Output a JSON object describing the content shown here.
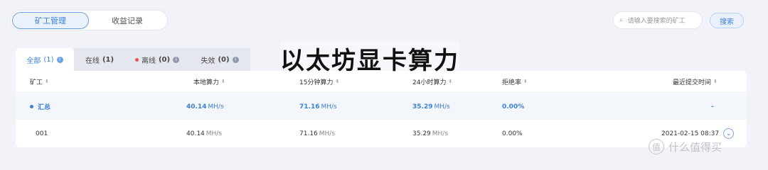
{
  "top_tabs": [
    {
      "label": "矿工管理",
      "active": true
    },
    {
      "label": "收益记录",
      "active": false
    }
  ],
  "search": {
    "placeholder": "请输入要搜索的矿工",
    "button": "搜索"
  },
  "overlay_title": "以太坊显卡算力",
  "status_tabs": {
    "all": {
      "label": "全部",
      "count": "(1)"
    },
    "online": {
      "label": "在线",
      "count": "(1)"
    },
    "offline": {
      "label": "离线",
      "count": "(0)"
    },
    "failed": {
      "label": "失效",
      "count": "(0)"
    }
  },
  "table": {
    "headers": {
      "worker": "矿工",
      "local": "本地算力",
      "m15": "15分钟算力",
      "h24": "24小时算力",
      "reject": "拒绝率",
      "last": "最近提交时间"
    },
    "summary": {
      "name": "汇总",
      "local": "40.14",
      "m15": "71.16",
      "h24": "35.29",
      "reject": "0.00%",
      "last": "-"
    },
    "rows": [
      {
        "name": "001",
        "local": "40.14",
        "m15": "71.16",
        "h24": "35.29",
        "reject": "0.00%",
        "last": "2021-02-15 08:37"
      }
    ],
    "unit": "MH/s"
  },
  "watermark": {
    "text": "什么值得买",
    "badge": "值"
  },
  "colors": {
    "accent": "#3a7fe0",
    "offline_dot": "#e8504a",
    "background": "#f1f3f8"
  }
}
